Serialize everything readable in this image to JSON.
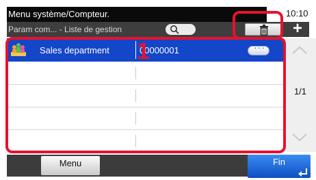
{
  "header": {
    "title": "Menu système/Compteur.",
    "clock": "10:10",
    "breadcrumb": "Param com... - Liste de gestion",
    "search_icon": "search-icon",
    "delete_icon": "trash-icon",
    "add_icon": "plus-icon",
    "add_symbol": "+"
  },
  "list": {
    "rows": [
      {
        "name": "Sales department",
        "number": "00000001",
        "icon": "group-icon",
        "selected": true
      },
      {
        "name": "",
        "number": "",
        "selected": false
      },
      {
        "name": "",
        "number": "",
        "selected": false
      },
      {
        "name": "",
        "number": "",
        "selected": false
      },
      {
        "name": "",
        "number": "",
        "selected": false
      }
    ]
  },
  "pagination": {
    "page_text": "1/1"
  },
  "annotation": {
    "callout_number": "1",
    "color": "#e8112d"
  },
  "footer": {
    "menu_label": "Menu",
    "fin_label": "Fin"
  },
  "colors": {
    "selected_row": "#1346c8",
    "accent": "#0d4fc5"
  }
}
